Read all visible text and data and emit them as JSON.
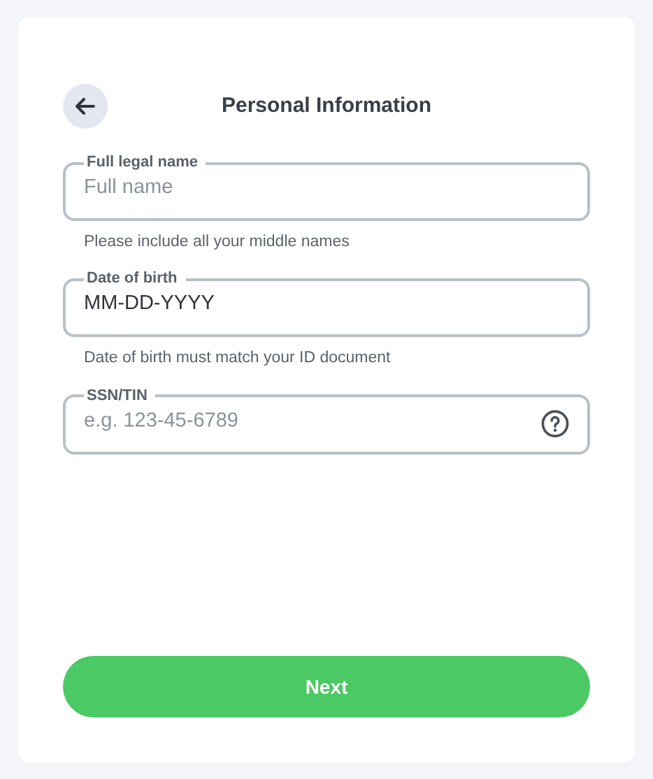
{
  "header": {
    "title": "Personal Information"
  },
  "fields": [
    {
      "kind": "plain",
      "label": "Full legal name",
      "placeholder": "Full name",
      "hint": "Please include all your middle names"
    },
    {
      "kind": "plain",
      "label": "Date of birth",
      "value": "MM-DD-YYYY",
      "hint": "Date of birth must match your ID document"
    },
    {
      "kind": "help",
      "label": "SSN/TIN",
      "placeholder": "e.g. 123-45-6789"
    }
  ],
  "buttons": [
    {
      "label": "Next"
    }
  ]
}
